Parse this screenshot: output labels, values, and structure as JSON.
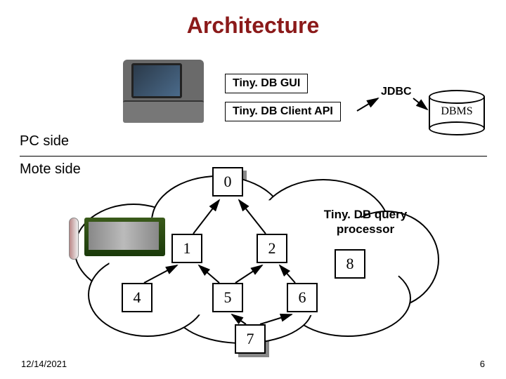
{
  "title": "Architecture",
  "pc_side_label": "PC side",
  "mote_side_label": "Mote side",
  "gui_label": "Tiny. DB GUI",
  "api_label": "Tiny. DB Client API",
  "jdbc_label": "JDBC",
  "dbms_label": "DBMS",
  "tinydb_text_line1": "Tiny. DB query",
  "tinydb_text_line2": "processor",
  "nodes": {
    "n0": "0",
    "n1": "1",
    "n2": "2",
    "n4": "4",
    "n5": "5",
    "n6": "6",
    "n7": "7",
    "n8": "8"
  },
  "footer_date": "12/14/2021",
  "footer_page": "6"
}
